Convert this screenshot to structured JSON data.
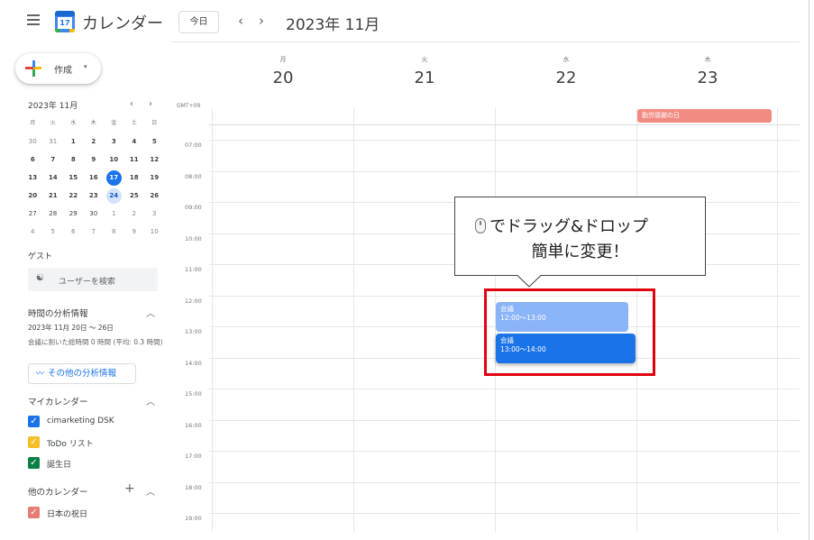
{
  "header": {
    "app_title": "カレンダー",
    "logo_number": "17",
    "today_label": "今日",
    "prev_label": "‹",
    "next_label": "›",
    "month_title": "2023年 11月"
  },
  "create": {
    "label": "作成",
    "caret": "▾"
  },
  "mini_calendar": {
    "title": "2023年 11月",
    "prev": "‹",
    "next": "›",
    "weekdays": [
      "月",
      "火",
      "水",
      "木",
      "金",
      "土",
      "日"
    ],
    "weeks": [
      [
        "30",
        "31",
        "1",
        "2",
        "3",
        "4",
        "5"
      ],
      [
        "6",
        "7",
        "8",
        "9",
        "10",
        "11",
        "12"
      ],
      [
        "13",
        "14",
        "15",
        "16",
        "17",
        "18",
        "19"
      ],
      [
        "20",
        "21",
        "22",
        "23",
        "24",
        "25",
        "26"
      ],
      [
        "27",
        "28",
        "29",
        "30",
        "1",
        "2",
        "3"
      ],
      [
        "4",
        "5",
        "6",
        "7",
        "8",
        "9",
        "10"
      ]
    ],
    "today": "17",
    "selected": "24"
  },
  "guests": {
    "title": "ゲスト",
    "search_label": "ユーザーを検索",
    "icon": "people-icon"
  },
  "insights": {
    "title": "時間の分析情報",
    "range": "2023年 11月 20日 ～ 26日",
    "text": "会議に割いた総時間 0 時間 (平均: 0.3 時間)",
    "more_label": "その他の分析情報"
  },
  "my_calendars": {
    "title": "マイカレンダー",
    "items": [
      {
        "label": "cimarketing DSK",
        "color": "#1a73e8"
      },
      {
        "label": "ToDo リスト",
        "color": "#f6bf26"
      },
      {
        "label": "誕生日",
        "color": "#0b8043"
      }
    ]
  },
  "other_calendars": {
    "title": "他のカレンダー",
    "add": "+",
    "items": [
      {
        "label": "日本の祝日",
        "color": "#e67c73"
      }
    ]
  },
  "week": {
    "days": [
      {
        "label": "月",
        "num": "20"
      },
      {
        "label": "火",
        "num": "21"
      },
      {
        "label": "水",
        "num": "22"
      },
      {
        "label": "木",
        "num": "23"
      }
    ],
    "timezone": "GMT+09",
    "times": [
      "07:00",
      "08:00",
      "09:00",
      "10:00",
      "11:00",
      "12:00",
      "13:00",
      "14:00",
      "15:00",
      "16:00",
      "17:00",
      "18:00",
      "19:00"
    ]
  },
  "events": {
    "holiday": "勤労感謝の日",
    "ev1_title": "会議",
    "ev1_time": "12:00～13:00",
    "ev2_title": "会議",
    "ev2_time": "13:00～14:00"
  },
  "callout": {
    "line1": "でドラッグ&ドロップ",
    "line2": "簡単に変更！"
  }
}
